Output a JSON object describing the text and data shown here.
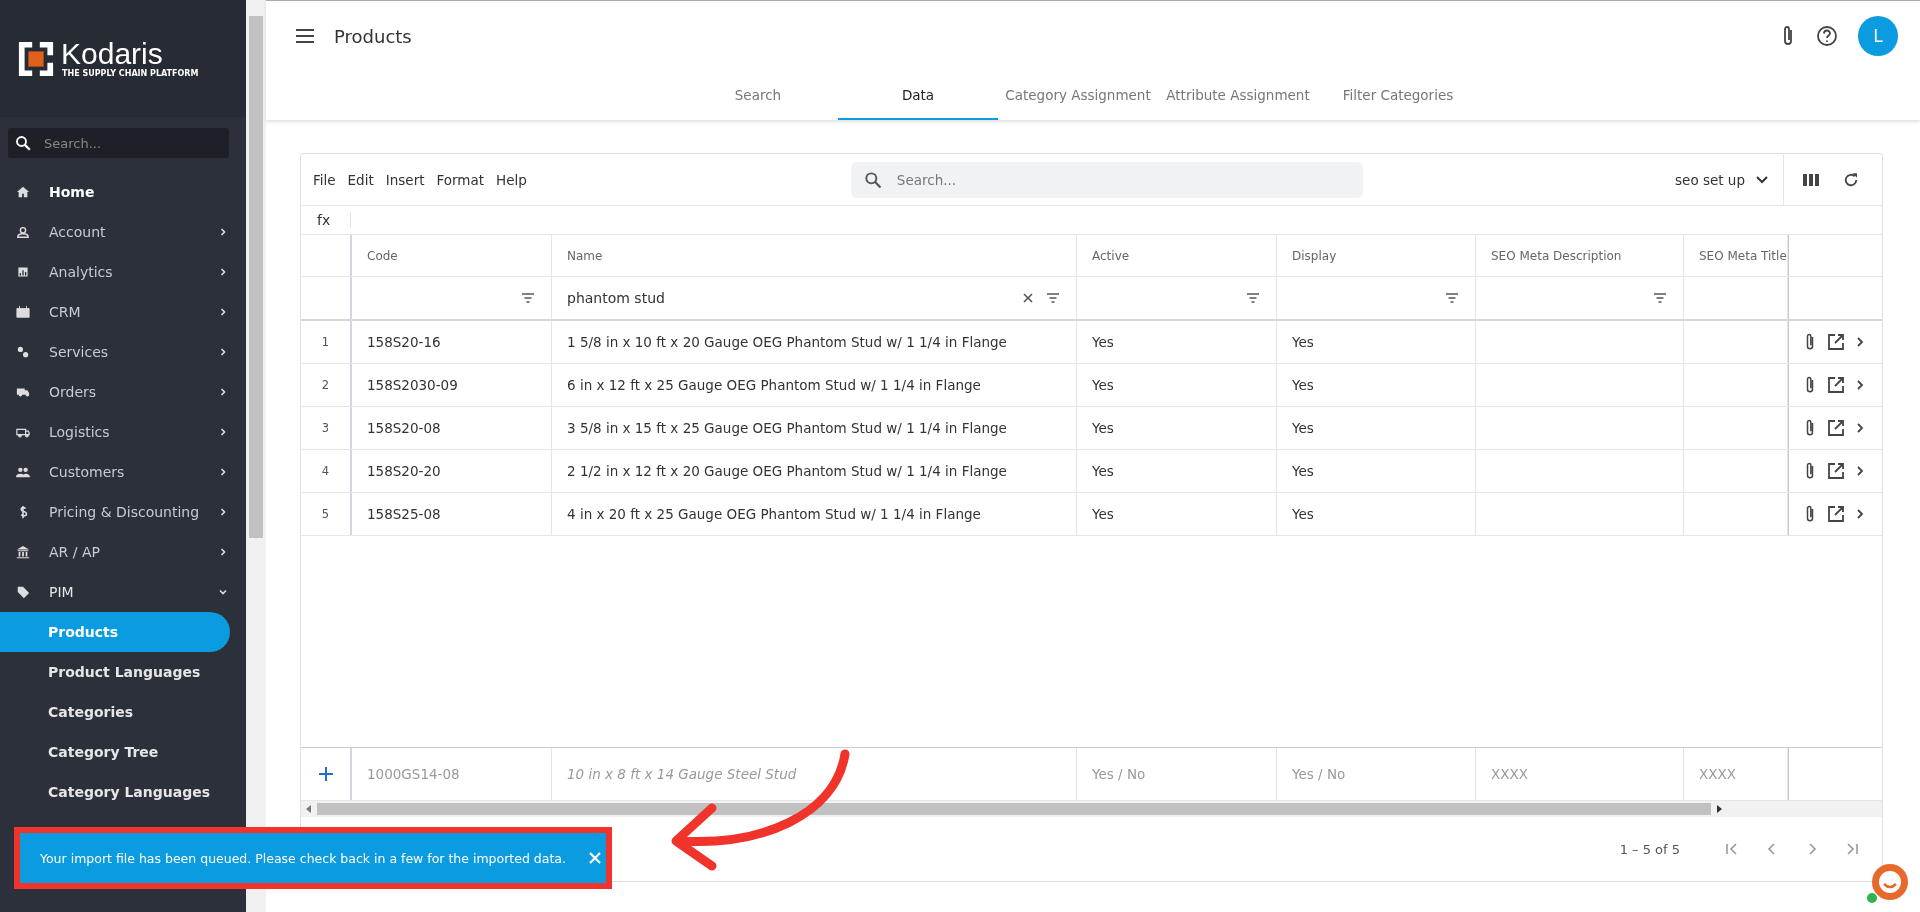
{
  "sidebar": {
    "logo": {
      "name": "Kodaris",
      "tagline": "THE SUPPLY CHAIN PLATFORM"
    },
    "search": {
      "placeholder": "Search..."
    },
    "items": [
      {
        "label": "Home",
        "has_children": false
      },
      {
        "label": "Account",
        "has_children": true,
        "expanded": false
      },
      {
        "label": "Analytics",
        "has_children": true,
        "expanded": false
      },
      {
        "label": "CRM",
        "has_children": true,
        "expanded": false
      },
      {
        "label": "Services",
        "has_children": true,
        "expanded": false
      },
      {
        "label": "Orders",
        "has_children": true,
        "expanded": false
      },
      {
        "label": "Logistics",
        "has_children": true,
        "expanded": false
      },
      {
        "label": "Customers",
        "has_children": true,
        "expanded": false
      },
      {
        "label": "Pricing & Discounting",
        "has_children": true,
        "expanded": false
      },
      {
        "label": "AR / AP",
        "has_children": true,
        "expanded": false
      },
      {
        "label": "PIM",
        "has_children": true,
        "expanded": true,
        "children": [
          {
            "label": "Products",
            "selected": true
          },
          {
            "label": "Product Languages",
            "selected": false
          },
          {
            "label": "Categories",
            "selected": false
          },
          {
            "label": "Category Tree",
            "selected": false
          },
          {
            "label": "Category Languages",
            "selected": false
          }
        ]
      }
    ]
  },
  "header": {
    "title": "Products",
    "avatar": "L"
  },
  "tabs": [
    {
      "label": "Search",
      "selected": false
    },
    {
      "label": "Data",
      "selected": true
    },
    {
      "label": "Category Assignment",
      "selected": false
    },
    {
      "label": "Attribute Assignment",
      "selected": false
    },
    {
      "label": "Filter Categories",
      "selected": false
    }
  ],
  "toolbar": {
    "menu": [
      "File",
      "Edit",
      "Insert",
      "Format",
      "Help"
    ],
    "search": {
      "placeholder": "Search..."
    },
    "view": "seo set up"
  },
  "formula_bar": {
    "label": "fx"
  },
  "table": {
    "columns": [
      {
        "label": "Code",
        "filter": true
      },
      {
        "label": "Name",
        "filter": true,
        "filter_value": "phantom stud"
      },
      {
        "label": "Active",
        "filter": true
      },
      {
        "label": "Display",
        "filter": true
      },
      {
        "label": "SEO Meta Description",
        "filter": true
      },
      {
        "label": "SEO Meta Title",
        "filter": false
      }
    ],
    "rows": [
      {
        "num": "1",
        "cells": [
          "158S20-16",
          "1 5/8 in x 10 ft x 20 Gauge OEG Phantom Stud w/ 1 1/4 in Flange",
          "Yes",
          "Yes"
        ]
      },
      {
        "num": "2",
        "cells": [
          "158S2030-09",
          "6 in x 12 ft x 25 Gauge OEG Phantom Stud w/ 1 1/4 in Flange",
          "Yes",
          "Yes"
        ]
      },
      {
        "num": "3",
        "cells": [
          "158S20-08",
          "3 5/8 in x 15 ft x 25 Gauge OEG Phantom Stud w/ 1 1/4 in Flange",
          "Yes",
          "Yes"
        ]
      },
      {
        "num": "4",
        "cells": [
          "158S20-20",
          "2 1/2 in x 12 ft x 20 Gauge OEG Phantom Stud w/ 1 1/4 in Flange",
          "Yes",
          "Yes"
        ]
      },
      {
        "num": "5",
        "cells": [
          "158S25-08",
          "4 in x 20 ft x 25 Gauge OEG Phantom Stud w/ 1 1/4 in Flange",
          "Yes",
          "Yes"
        ]
      }
    ],
    "new_row": {
      "placeholders": [
        "1000GS14-08",
        "10 in x 8 ft x 14 Gauge Steel Stud",
        "Yes / No",
        "Yes / No",
        "XXXX",
        "XXXX"
      ]
    }
  },
  "pagination": {
    "range": "1 – 5 of 5"
  },
  "snackbar": {
    "message": "Your import file has been queued. Please check back in a few for the imported data."
  }
}
